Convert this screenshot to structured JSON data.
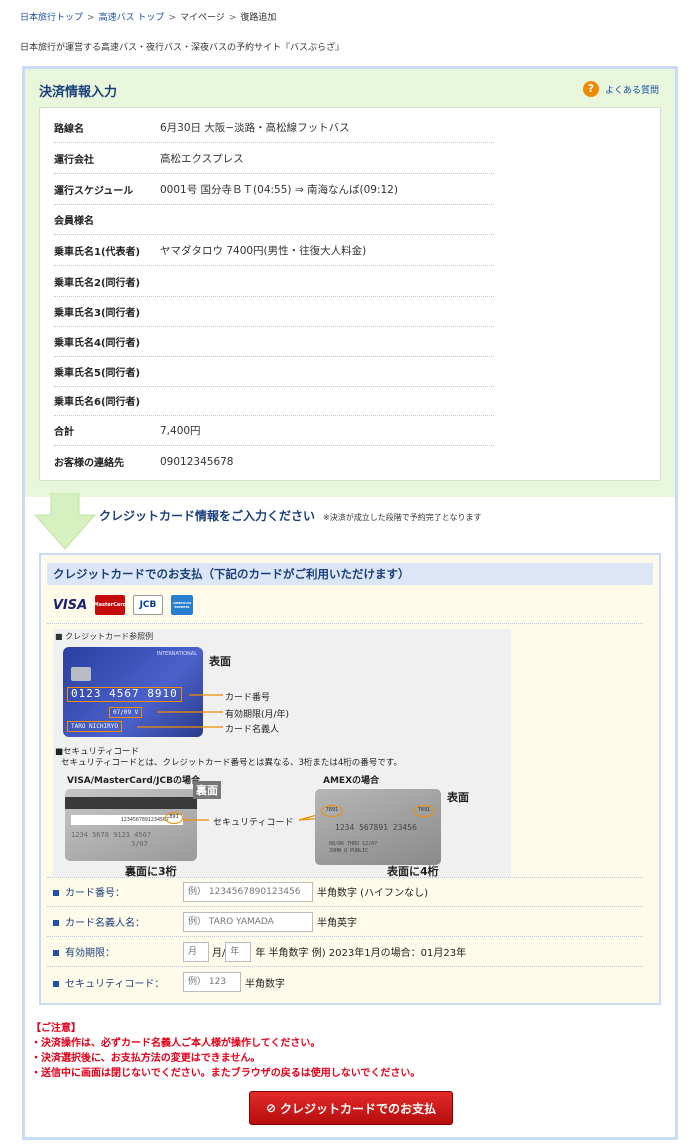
{
  "breadcrumb": {
    "items": [
      "日本旅行トップ",
      "高速バス トップ",
      "マイページ",
      "復路追加"
    ]
  },
  "tagline": "日本旅行が運営する高速バス・夜行バス・深夜バスの予約サイト『バスぷらざ』",
  "page": {
    "title": "決済情報入力",
    "faq_label": "よくある質問"
  },
  "trip": {
    "rows": [
      {
        "label": "路線名",
        "value": "6月30日 大阪−淡路・高松線フットバス"
      },
      {
        "label": "運行会社",
        "value": "高松エクスプレス"
      },
      {
        "label": "運行スケジュール",
        "value": "0001号 国分寺ＢＴ(04:55) ⇒ 南海なんば(09:12)"
      },
      {
        "label": "会員様名",
        "value": ""
      },
      {
        "label": "乗車氏名1(代表者)",
        "value": "ヤマダタロウ 7400円(男性・往復大人料金)"
      },
      {
        "label": "乗車氏名2(同行者)",
        "value": ""
      },
      {
        "label": "乗車氏名3(同行者)",
        "value": ""
      },
      {
        "label": "乗車氏名4(同行者)",
        "value": ""
      },
      {
        "label": "乗車氏名5(同行者)",
        "value": ""
      },
      {
        "label": "乗車氏名6(同行者)",
        "value": ""
      },
      {
        "label": "合計",
        "value": "7,400円"
      },
      {
        "label": "お客様の連絡先",
        "value": "09012345678"
      }
    ]
  },
  "prompt": {
    "text": "クレジットカード情報をご入力ください",
    "note": "※決済が成立した段階で予約完了となります"
  },
  "card_section": {
    "title": "クレジットカードでのお支払（下記のカードがご利用いただけます）",
    "logos": [
      "VISA",
      "MasterCard",
      "JCB",
      "AMERICAN EXPRESS"
    ],
    "ref_label": "■ クレジットカード参照例",
    "card_intl": "INTERNATIONAL",
    "card_number": "0123 4567 8910",
    "card_exp": "07/09 V",
    "card_holder": "TARO NICHIRYO",
    "front_label": "表面",
    "label_number": "カード番号",
    "label_expiry": "有効期限(月/年)",
    "label_holder": "カード名義人",
    "sec_title": "■セキュリティコード",
    "sec_desc": "セキュリティコードとは、クレジットカード番号とは異なる、3桁または4桁の番号です。",
    "vmj_label": "VISA/MasterCard/JCBの場合",
    "amex_label": "AMEXの場合",
    "back_badge": "裏面",
    "back_sig": "1234567891234567",
    "back_code": "891",
    "back_nums": "1234 5678 9123 4567",
    "back_nums2": "3/07",
    "sec_code_label": "セキュリティコード",
    "back_caption": "裏面に3桁",
    "amex_front": "表面",
    "amex_code": "7891",
    "amex_num": "1234 567891 23456",
    "amex_small1": "08/06 THRU 12/07",
    "amex_small2": "JOHN Q PUBLIC",
    "amex_caption": "表面に4桁"
  },
  "form": {
    "card_number": {
      "label": "カード番号：",
      "placeholder": "例） 1234567890123456",
      "hint": "半角数字 (ハイフンなし)"
    },
    "holder": {
      "label": "カード名義人名：",
      "placeholder": "例） TARO YAMADA",
      "hint": "半角英字"
    },
    "expiry": {
      "label": "有効期限：",
      "month_placeholder": "月",
      "month_unit": "月/",
      "year_placeholder": "年",
      "hint": "年 半角数字 例) 2023年1月の場合：01月23年"
    },
    "security": {
      "label": "セキュリティコード：",
      "placeholder": "例） 123",
      "hint": "半角数字"
    }
  },
  "notice": {
    "title": "【ご注意】",
    "lines": [
      "・決済操作は、必ずカード名義人ご本人様が操作してください。",
      "・決済選択後に、お支払方法の変更はできません。",
      "・送信中に画面は閉じないでください。またブラウザの戻るは使用しないでください。"
    ]
  },
  "submit_label": "クレジットカードでのお支払",
  "colors": {
    "accent": "#1a3f7a",
    "green_bg": "#e8f7dc",
    "warning": "#e0001a",
    "button": "#c41414"
  }
}
